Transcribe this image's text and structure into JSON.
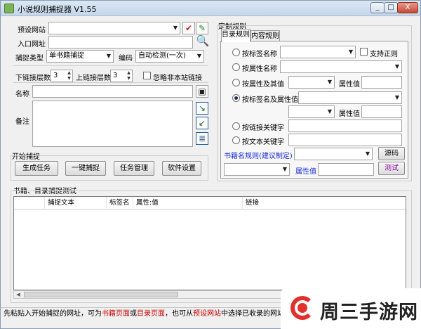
{
  "window": {
    "title": "小说规则捕捉器 V1.55",
    "min_label": "_",
    "max_label": "□",
    "close_label": "X"
  },
  "left": {
    "preset_site_label": "预设网站",
    "preset_site_value": "",
    "entry_url_label": "入口网址",
    "entry_url_value": "",
    "capture_type_label": "捕捉类型",
    "capture_type_value": "单书籍捕捉",
    "encoding_label": "编码",
    "encoding_value": "自动检测(一次)",
    "lower_depth_label": "下链接层数",
    "lower_depth_value": "3",
    "upper_depth_label": "上链接层数",
    "upper_depth_value": "3",
    "ignore_offsite_label": "忽略非本站链接",
    "name_label": "名称",
    "name_value": "",
    "notes_label": "备注",
    "notes_value": ""
  },
  "start": {
    "group_label": "开始捕捉",
    "buttons": [
      "生成任务",
      "一键捕捉",
      "任务管理",
      "软件设置"
    ]
  },
  "rules": {
    "group_label": "定制规则",
    "tabs": [
      "目录规则",
      "内容规则"
    ],
    "active_tab": 0,
    "by_tag_label": "按标签名称",
    "support_regex_label": "支持正则",
    "by_attr_name_label": "按属性名称",
    "by_attr_value_label": "按属性及其值",
    "attr_value_label_1": "属性值",
    "by_tag_attr_label": "按标签名及属性值",
    "attr_value_label_2": "属性值",
    "by_link_keyword_label": "按链接关键字",
    "by_text_keyword_label": "按文本关键字",
    "selected_option": "by_tag_attr"
  },
  "book_rule": {
    "label": "书籍名规则(建议制定)",
    "attr_value_label": "属性值",
    "source_button": "源码",
    "test_button": "测试"
  },
  "results": {
    "group_label": "书籍、目录捕捉测试",
    "columns": [
      "捕捉文本",
      "标签名",
      "属性:值",
      "链接"
    ]
  },
  "status": {
    "part1": "先粘贴入开始捕捉的网址，可为",
    "link1": "书籍页面",
    "part2": "或",
    "link2": "目录页面",
    "part3": "，也可从",
    "link3": "预设网站",
    "part4": "中选择已收录的网站"
  },
  "watermark": {
    "text": "周三手游网"
  },
  "colors": {
    "status_red": "#cc0000",
    "status_blue": "#1a2bd6",
    "watermark_red": "#e2312c"
  }
}
